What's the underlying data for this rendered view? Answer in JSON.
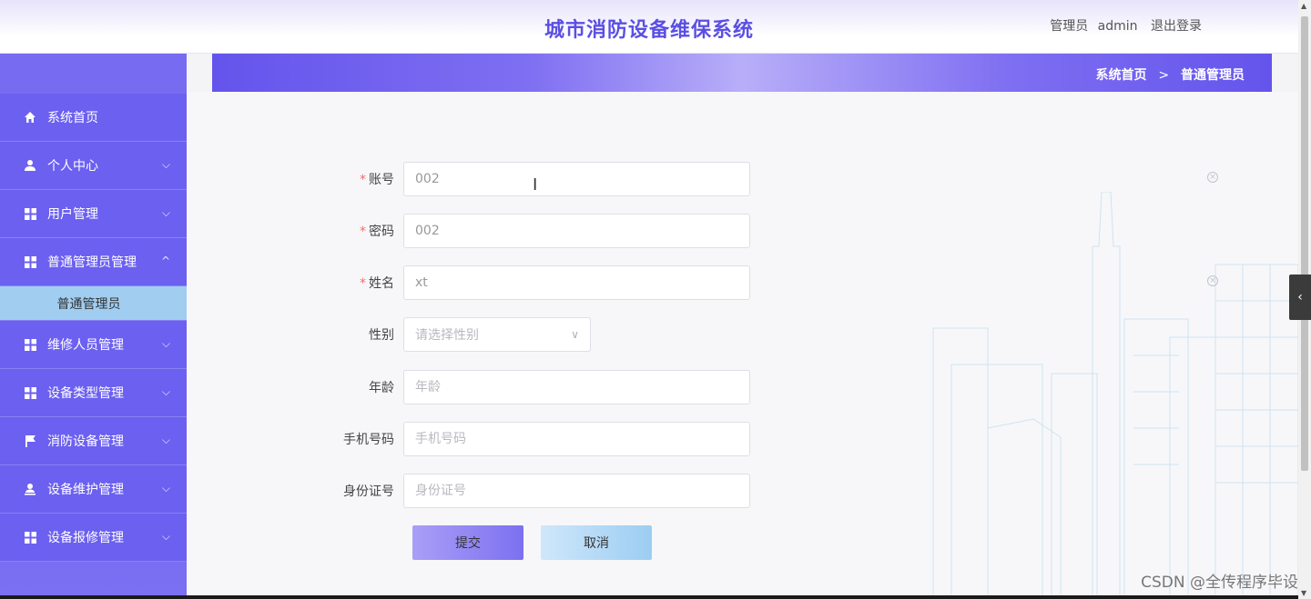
{
  "header": {
    "title": "城市消防设备维保系统",
    "user_role": "管理员",
    "user_name": "admin",
    "logout": "退出登录"
  },
  "sidebar": {
    "items": [
      {
        "label": "系统首页",
        "icon": "home-icon"
      },
      {
        "label": "个人中心",
        "icon": "user-icon"
      },
      {
        "label": "用户管理",
        "icon": "grid-icon"
      },
      {
        "label": "普通管理员管理",
        "icon": "grid-icon"
      },
      {
        "label": "维修人员管理",
        "icon": "grid-icon"
      },
      {
        "label": "设备类型管理",
        "icon": "grid-icon"
      },
      {
        "label": "消防设备管理",
        "icon": "flag-icon"
      },
      {
        "label": "设备维护管理",
        "icon": "user-upload-icon"
      },
      {
        "label": "设备报修管理",
        "icon": "grid-icon"
      }
    ],
    "sub_item": "普通管理员"
  },
  "breadcrumb": {
    "home": "系统首页",
    "separator": ">",
    "current": "普通管理员"
  },
  "form": {
    "account": {
      "label": "账号",
      "value": "002"
    },
    "password": {
      "label": "密码",
      "value": "002"
    },
    "name": {
      "label": "姓名",
      "value": "xt"
    },
    "gender": {
      "label": "性别",
      "placeholder": "请选择性别"
    },
    "age": {
      "label": "年龄",
      "placeholder": "年龄"
    },
    "phone": {
      "label": "手机号码",
      "placeholder": "手机号码"
    },
    "id_card": {
      "label": "身份证号",
      "placeholder": "身份证号"
    },
    "required_mark": "*"
  },
  "buttons": {
    "submit": "提交",
    "cancel": "取消"
  },
  "watermark": "CSDN @全传程序毕设",
  "colors": {
    "accent": "#6c60f0",
    "title": "#5b4fe3",
    "submenu_active": "#a0cdf0"
  }
}
